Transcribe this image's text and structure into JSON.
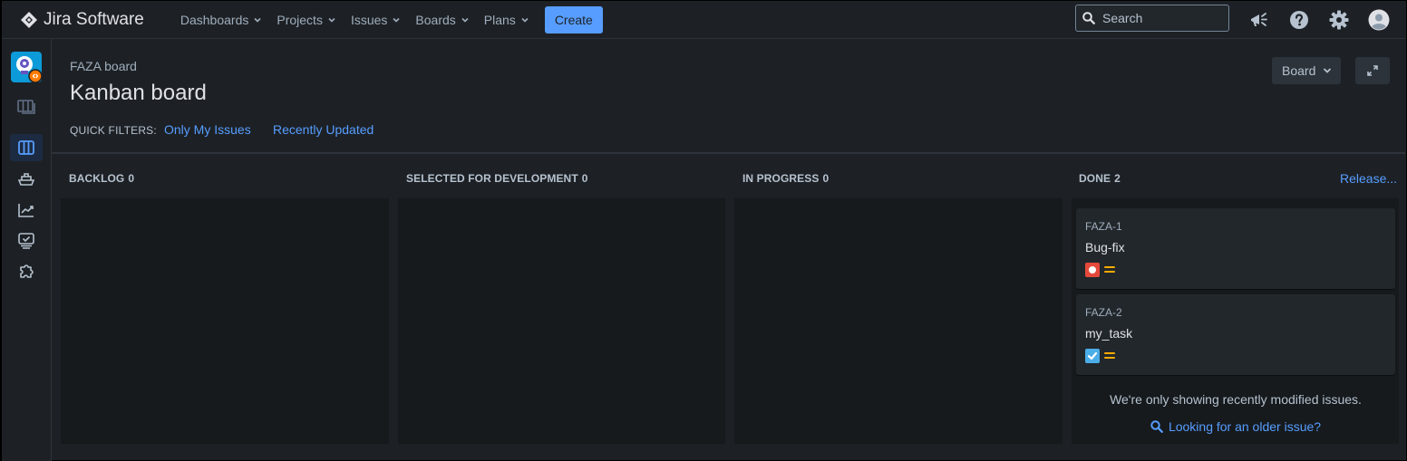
{
  "app": {
    "name": "Jira Software"
  },
  "nav": {
    "items": [
      {
        "label": "Dashboards"
      },
      {
        "label": "Projects"
      },
      {
        "label": "Issues"
      },
      {
        "label": "Boards"
      },
      {
        "label": "Plans"
      }
    ],
    "create_label": "Create",
    "search_placeholder": "Search"
  },
  "header": {
    "breadcrumb": "FAZA board",
    "title": "Kanban board",
    "board_button": "Board",
    "quick_filters_label": "QUICK FILTERS:",
    "quick_filters": [
      "Only My Issues",
      "Recently Updated"
    ]
  },
  "columns": [
    {
      "name": "BACKLOG",
      "count": "0"
    },
    {
      "name": "SELECTED FOR DEVELOPMENT",
      "count": "0"
    },
    {
      "name": "IN PROGRESS",
      "count": "0"
    },
    {
      "name": "DONE",
      "count": "2"
    }
  ],
  "release_label": "Release...",
  "cards": [
    {
      "key": "FAZA-1",
      "summary": "Bug-fix",
      "type_icon": "bug-icon",
      "type_color": "#e5493a",
      "priority": "medium"
    },
    {
      "key": "FAZA-2",
      "summary": "my_task",
      "type_icon": "task-icon",
      "type_color": "#4bade8",
      "priority": "medium"
    }
  ],
  "done_footer": {
    "note": "We're only showing recently modified issues.",
    "link": "Looking for an older issue?"
  },
  "colors": {
    "accent": "#579dff",
    "background": "#1d2125",
    "column_bg": "#161a1d",
    "priority_medium": "#ffab00"
  }
}
